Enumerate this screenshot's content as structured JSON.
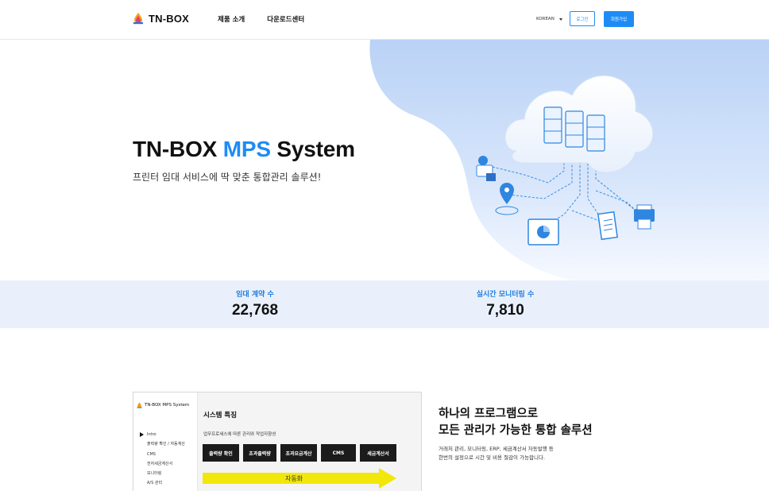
{
  "header": {
    "brand": "TN-BOX",
    "nav": [
      "제품 소개",
      "다운로드센터"
    ],
    "language": "KOREAN",
    "login_label": "로그인",
    "signup_label": "회원가입"
  },
  "hero": {
    "title_part1": "TN-BOX ",
    "title_accent": "MPS",
    "title_part2": " System",
    "subtitle": "프린터 임대 서비스에 딱 맞춘 통합관리 솔루션!"
  },
  "stats": [
    {
      "label": "임대 계약 수",
      "value": "22,768"
    },
    {
      "label": "실시간 모니터링 수",
      "value": "7,810"
    }
  ],
  "preview": {
    "brand": "TN-BOX MPS System",
    "menu": [
      "Intro",
      "출력량 확인 / 자동계산",
      "CMS",
      "전자세금계산서",
      "모니터링",
      "A/S 관리"
    ],
    "heading": "시스템 특징",
    "description": "업무프로세스에 따른 관리와 작업자향성",
    "steps": [
      "출력량 확인",
      "초과출력량",
      "초과요금계산",
      "CMS",
      "세금계산서"
    ],
    "arrow_label": "자동화"
  },
  "feature": {
    "title_line1": "하나의 프로그램으로",
    "title_line2": "모든 관리가 가능한 통합 솔루션",
    "desc_line1": "거래처 관리, 모니터링, ERP, 세금계산서 자동발행 등",
    "desc_line2": "한번의 설정으로 시간 및 비용 절감이 가능합니다."
  },
  "colors": {
    "accent": "#1e8cf6",
    "stats_band": "#e9f0fb",
    "hero_blob": "#c9dcf8"
  },
  "icons": {
    "logo": "color-drop-icon",
    "hero_illustration": "cloud-network-illustration",
    "language_caret": "caret-down-icon",
    "menu_marker": "triangle-right-icon"
  }
}
